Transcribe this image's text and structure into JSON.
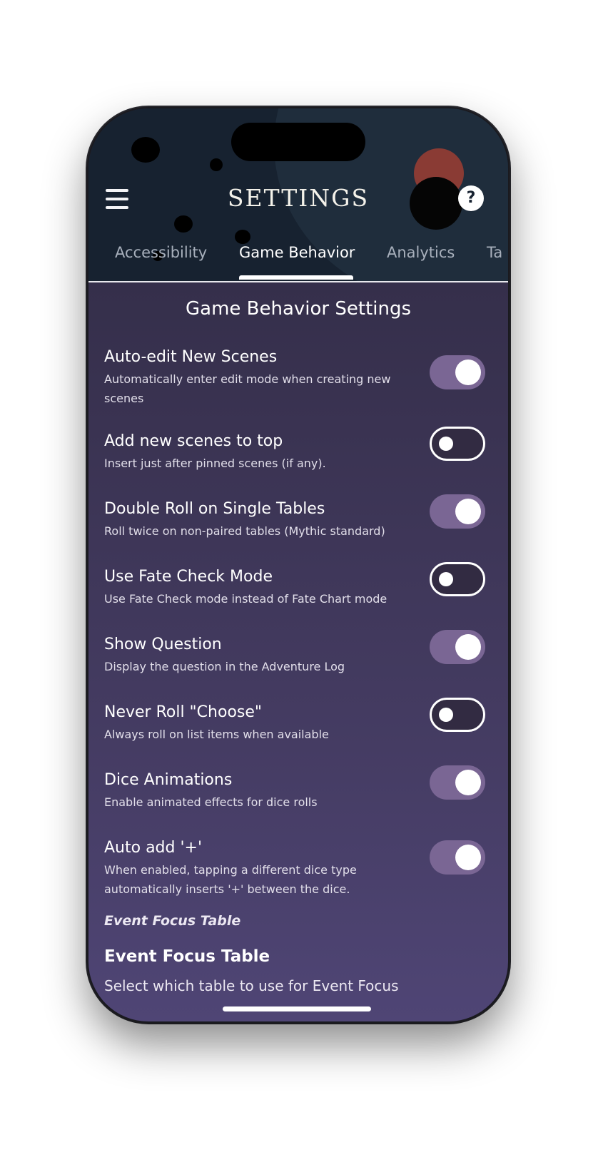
{
  "header": {
    "title": "SETTINGS",
    "help_label": "?",
    "tabs": [
      {
        "label": "Accessibility",
        "active": false
      },
      {
        "label": "Game Behavior",
        "active": true
      },
      {
        "label": "Analytics",
        "active": false
      },
      {
        "label": "Ta",
        "active": false
      }
    ]
  },
  "main": {
    "section_title": "Game Behavior Settings",
    "settings": [
      {
        "label": "Auto-edit New Scenes",
        "description": "Automatically enter edit mode when creating new scenes",
        "enabled": true
      },
      {
        "label": "Add new scenes to top",
        "description": "Insert just after pinned scenes (if any).",
        "enabled": false
      },
      {
        "label": "Double Roll on Single Tables",
        "description": "Roll twice on non-paired tables (Mythic standard)",
        "enabled": true
      },
      {
        "label": "Use Fate Check Mode",
        "description": "Use Fate Check mode instead of Fate Chart mode",
        "enabled": false
      },
      {
        "label": "Show Question",
        "description": "Display the question in the Adventure Log",
        "enabled": true
      },
      {
        "label": "Never Roll \"Choose\"",
        "description": "Always roll on list items when available",
        "enabled": false
      },
      {
        "label": "Dice Animations",
        "description": "Enable animated effects for dice rolls",
        "enabled": true
      },
      {
        "label": "Auto add '+'",
        "description": "When enabled, tapping a different dice type automatically inserts '+' between the dice.",
        "enabled": true
      }
    ],
    "event_focus_subheader": "Event Focus Table",
    "event_focus_title": "Event Focus Table",
    "event_focus_description": "Select which table to use for Event Focus"
  },
  "colors": {
    "header_bg": "#172230",
    "toggle_on": "#7a6694",
    "toggle_off": "#322b42",
    "content_top": "#2f2a42",
    "content_bottom": "#4f4575"
  }
}
